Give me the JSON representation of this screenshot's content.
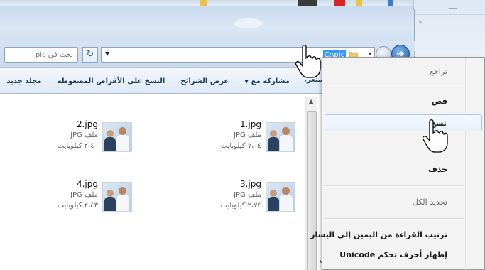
{
  "explorer": {
    "search": {
      "placeholder": "بحث في pic"
    },
    "address": {
      "path": "C:\\pic"
    },
    "toolbar": {
      "items": [
        {
          "label": "مشاركة مع",
          "has_dropdown": true
        },
        {
          "label": "عرض الشرائح"
        },
        {
          "label": "النسخ على الأقراص المضغوطة"
        },
        {
          "label": "مجلد جديد"
        }
      ],
      "clipped_item": "المستعرض"
    },
    "files": [
      {
        "name": "1.jpg",
        "type": "ملف JPG",
        "size": "٧،٠٤ كيلوبايت"
      },
      {
        "name": "2.jpg",
        "type": "ملف JPG",
        "size": "٢،٤٠ كيلوبايت"
      },
      {
        "name": "3.jpg",
        "type": "ملف JPG",
        "size": "٢،٧٤ كيلوبايت"
      },
      {
        "name": "4.jpg",
        "type": "ملف JPG",
        "size": "٢،٤٣ كيلوبايت"
      }
    ],
    "edge_char": "ب"
  },
  "context_menu": {
    "items": [
      {
        "label": "تراجع",
        "state": "disabled"
      },
      {
        "label": "قص",
        "state": "enabled"
      },
      {
        "label": "نسخ",
        "state": "hover"
      },
      {
        "label": "لصق",
        "state": "disabled"
      },
      {
        "label": "حذف",
        "state": "enabled"
      },
      {
        "label": "تحديد الكل",
        "state": "disabled"
      },
      {
        "label": "ترتيب القراءة من اليمين إلى اليسار",
        "state": "enabled"
      },
      {
        "label": "إظهار أحرف تحكم Unicode",
        "state": "enabled"
      }
    ]
  },
  "colors": {
    "selection": "#3399ff",
    "toolbar_text": "#1e395b",
    "menu_hover_border": "#a8c8ec",
    "nav_button": "#1d5aa8"
  },
  "icons": [
    "refresh-icon",
    "folder-icon",
    "back-icon",
    "forward-icon",
    "hand-cursor-icon"
  ]
}
